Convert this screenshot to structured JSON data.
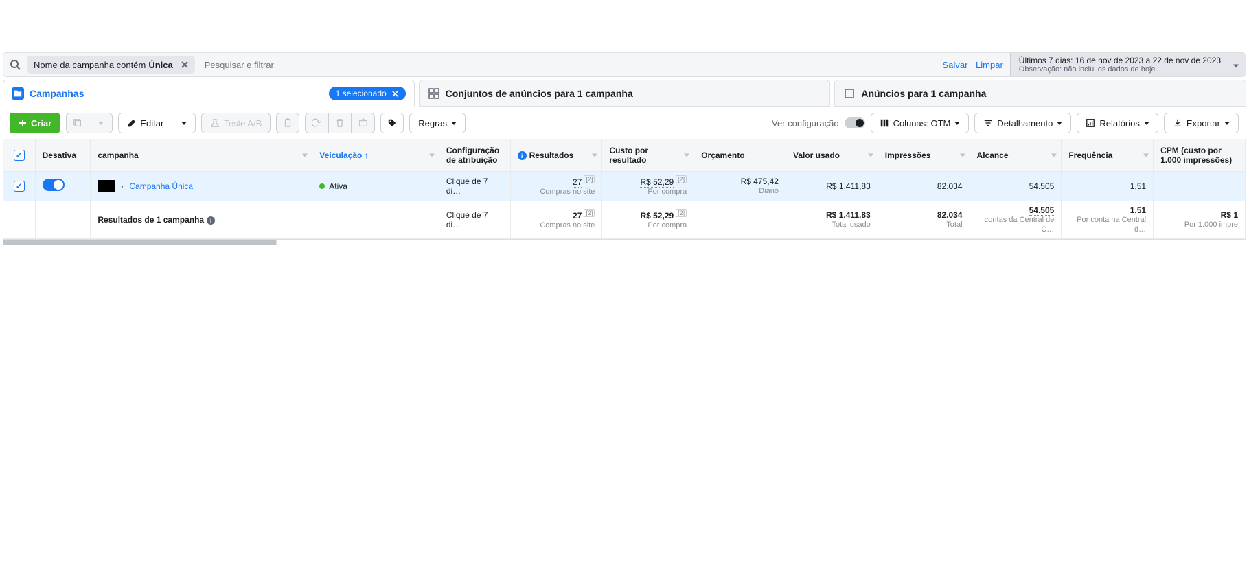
{
  "search": {
    "filter_chip_prefix": "Nome da campanha contém ",
    "filter_chip_value": "Única",
    "placeholder": "Pesquisar e filtrar",
    "save": "Salvar",
    "clear": "Limpar"
  },
  "daterange": {
    "line1": "Últimos 7 dias: 16 de nov de 2023 a 22 de nov de 2023",
    "line2": "Observação: não inclui os dados de hoje"
  },
  "tabs": {
    "campaigns": "Campanhas",
    "selected_badge": "1 selecionado",
    "adsets": "Conjuntos de anúncios para 1 campanha",
    "ads": "Anúncios para 1 campanha"
  },
  "toolbar": {
    "create": "Criar",
    "edit": "Editar",
    "ab_test": "Teste A/B",
    "rules": "Regras",
    "view_config": "Ver configuração",
    "columns": "Colunas: OTM",
    "breakdown": "Detalhamento",
    "reports": "Relatórios",
    "export": "Exportar"
  },
  "columns": {
    "off_on": "Desativa",
    "campaign": "campanha",
    "delivery": "Veiculação",
    "attribution": "Configuração de atribuição",
    "results": "Resultados",
    "cost_per_result": "Custo por resultado",
    "budget": "Orçamento",
    "amount_spent": "Valor usado",
    "impressions": "Impressões",
    "reach": "Alcance",
    "frequency": "Frequência",
    "cpm": "CPM (custo por 1.000 impressões)"
  },
  "rows": [
    {
      "name": "Campanha Única",
      "prefix": " · ",
      "status": "Ativa",
      "attribution": "Clique de 7 di…",
      "results": "27",
      "results_sup": "[2]",
      "results_sub": "Compras no site",
      "cpr": "R$ 52,29",
      "cpr_sup": "[2]",
      "cpr_sub": "Por compra",
      "budget": "R$ 475,42",
      "budget_sub": "Diário",
      "spent": "R$ 1.411,83",
      "impressions": "82.034",
      "reach": "54.505",
      "frequency": "1,51",
      "cpm": ""
    }
  ],
  "summary": {
    "label": "Resultados de 1 campanha",
    "attribution": "Clique de 7 di…",
    "results": "27",
    "results_sup": "[2]",
    "results_sub": "Compras no site",
    "cpr": "R$ 52,29",
    "cpr_sup": "[2]",
    "cpr_sub": "Por compra",
    "spent": "R$ 1.411,83",
    "spent_sub": "Total usado",
    "impressions": "82.034",
    "impressions_sub": "Total",
    "reach": "54.505",
    "reach_sub": "contas da Central de C…",
    "frequency": "1,51",
    "frequency_sub": "Por conta na Central d…",
    "cpm": "R$ 1",
    "cpm_sub": "Por 1.000 impre"
  }
}
